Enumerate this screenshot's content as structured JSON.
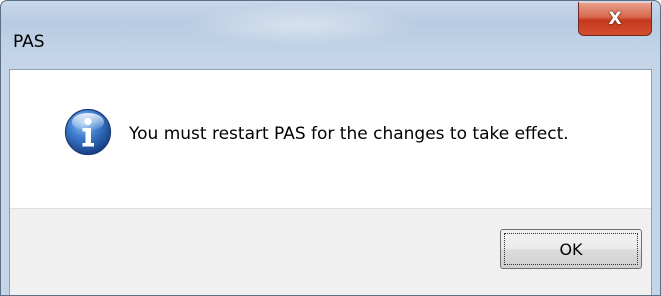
{
  "window": {
    "title": "PAS"
  },
  "title_controls": {
    "close_icon": "close-icon",
    "close_glyph": "X"
  },
  "dialog": {
    "icon": "info-icon",
    "message": "You must restart PAS for the changes to take effect.",
    "ok_label": "OK"
  },
  "colors": {
    "frame": "#c4d5e8",
    "close_button": "#c4391d",
    "icon_blue": "#2a5fb0",
    "footer": "#f0f0f0"
  }
}
